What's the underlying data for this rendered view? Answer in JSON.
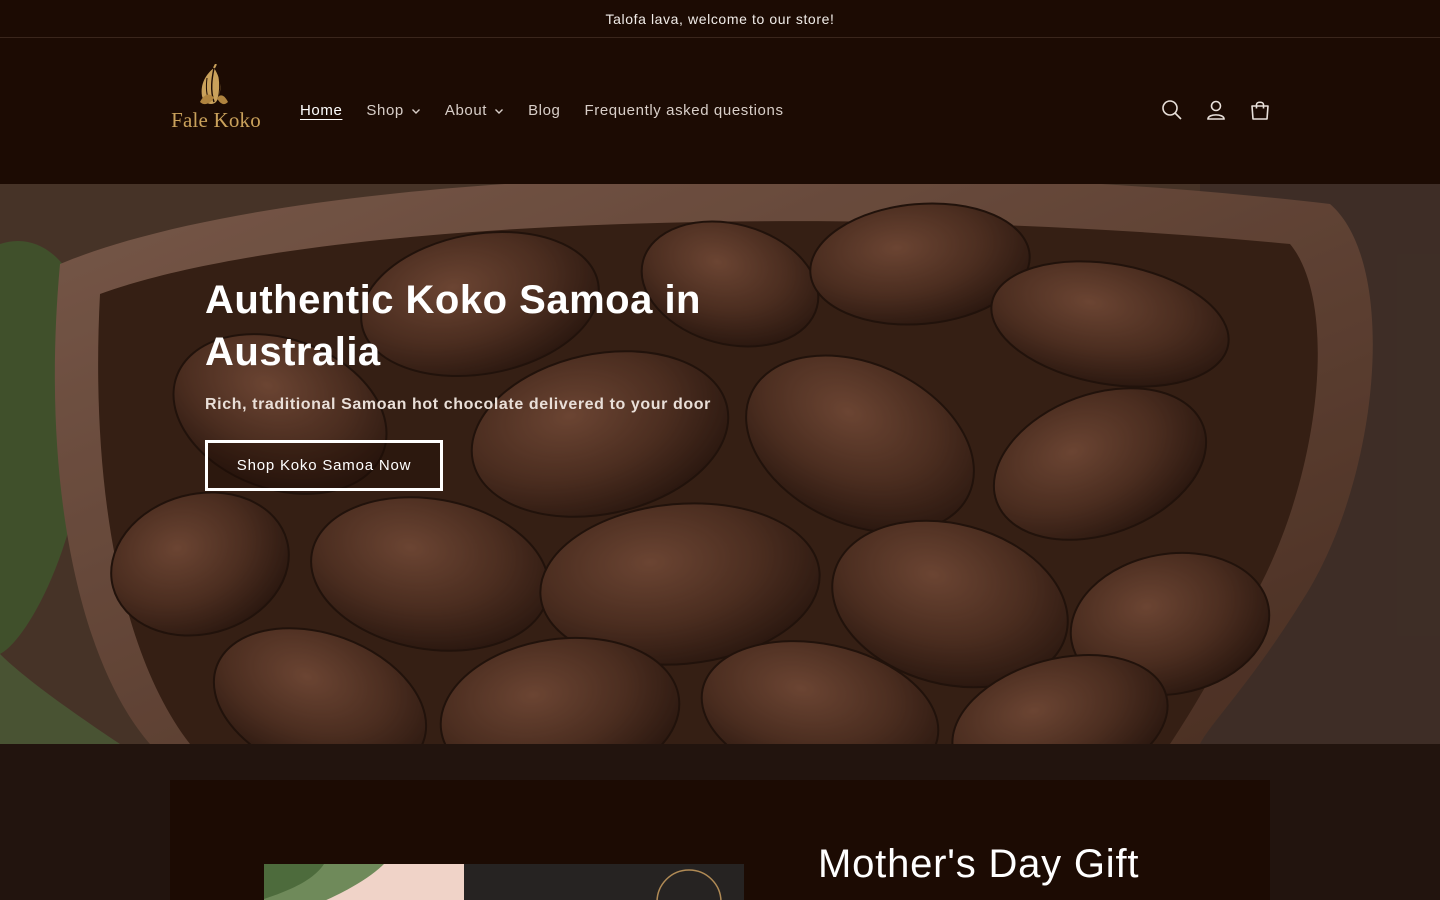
{
  "announcement": {
    "text": "Talofa lava, welcome to our store!"
  },
  "header": {
    "logo_text": "Fale Koko",
    "nav": [
      {
        "label": "Home",
        "active": true,
        "has_dropdown": false
      },
      {
        "label": "Shop",
        "active": false,
        "has_dropdown": true
      },
      {
        "label": "About",
        "active": false,
        "has_dropdown": true
      },
      {
        "label": "Blog",
        "active": false,
        "has_dropdown": false
      },
      {
        "label": "Frequently asked questions",
        "active": false,
        "has_dropdown": false
      }
    ],
    "icons": [
      "search-icon",
      "account-icon",
      "cart-icon"
    ]
  },
  "hero": {
    "title": "Authentic Koko Samoa in Australia",
    "subtitle": "Rich, traditional Samoan hot chocolate delivered to your door",
    "button_label": "Shop Koko Samoa Now"
  },
  "feature": {
    "title": "Mother's Day Gift"
  },
  "colors": {
    "header_bg": "#1c0b03",
    "page_bg": "#22140e",
    "logo_gold": "#c9a15b",
    "text_light": "#ffffff"
  }
}
